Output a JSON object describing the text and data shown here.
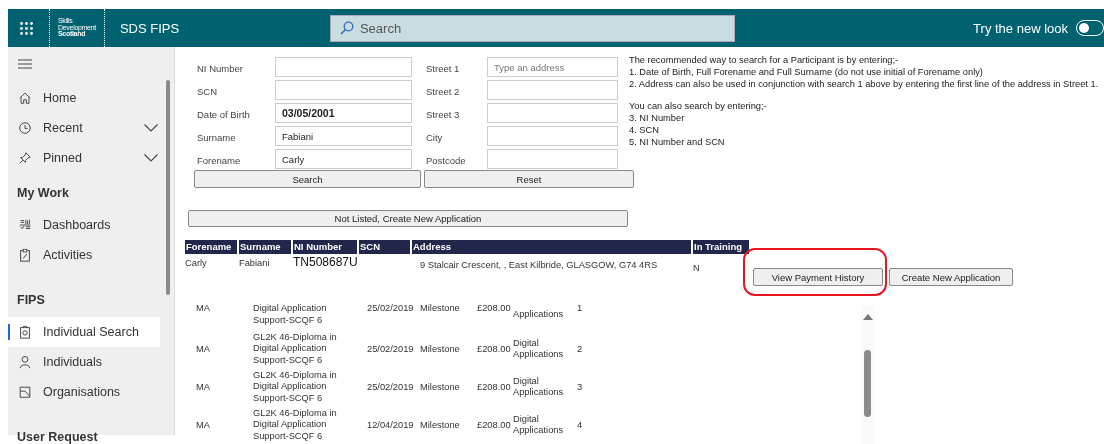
{
  "top_bar": {
    "logo_lines": [
      "Skills",
      "Development",
      "Scotland"
    ],
    "app_name": "SDS FIPS",
    "search": {
      "placeholder": "Search"
    },
    "new_look": {
      "label": "Try the new look",
      "on": false
    }
  },
  "sidebar": {
    "items": [
      {
        "kind": "link",
        "label": "Home",
        "selected": false
      },
      {
        "kind": "group",
        "label": "Recent",
        "selected": false
      },
      {
        "kind": "group",
        "label": "Pinned",
        "selected": false
      },
      {
        "kind": "heading",
        "label": "My Work"
      },
      {
        "kind": "link",
        "label": "Dashboards",
        "selected": false
      },
      {
        "kind": "link",
        "label": "Activities",
        "selected": false
      },
      {
        "kind": "heading",
        "label": "FIPS"
      },
      {
        "kind": "link",
        "label": "Individual Search",
        "selected": true
      },
      {
        "kind": "link",
        "label": "Individuals",
        "selected": false
      },
      {
        "kind": "link",
        "label": "Organisations",
        "selected": false
      },
      {
        "kind": "heading",
        "label": "User Request"
      }
    ]
  },
  "form": {
    "left_fields": [
      {
        "label": "NI Number"
      },
      {
        "label": "SCN"
      },
      {
        "label": "Date of Birth",
        "value": "03/05/2001"
      },
      {
        "label": "Surname",
        "value": "Fabiani"
      },
      {
        "label": "Forename",
        "value": "Carly"
      }
    ],
    "right_fields": [
      {
        "label": "Street 1",
        "placeholder": "Type an address"
      },
      {
        "label": "Street 2"
      },
      {
        "label": "Street 3"
      },
      {
        "label": "City"
      },
      {
        "label": "Postcode"
      }
    ],
    "instructions": [
      [
        "The recommended way to search for a Participant is by entering;-",
        "1. Date of Birth, Full Forename and Full Surname (do not use initial of Forename only)",
        "2. Address can also be used in conjunction with search 1 above by entering the first line of the address in Street 1."
      ],
      [
        "You can also search by entering;-",
        "3. NI Number",
        "4. SCN",
        "5. NI Number and SCN"
      ]
    ],
    "search_button": "Search",
    "reset_button": "Reset"
  },
  "create_button": "Not Listed, Create New Application",
  "results": {
    "columns": [
      "Forename",
      "Surname",
      "NI Number",
      "SCN",
      "Address",
      "In Training"
    ],
    "rows": [
      {
        "forename": "Carly",
        "surname": "Fabiani",
        "ni_number": "TN508687U",
        "address": "9 Stalcair Crescent,  , East Kilbride, GLASGOW, G74  4RS",
        "in_training": "N"
      }
    ],
    "buttons": [
      "View Payment History",
      "Create New Application"
    ]
  },
  "payments": [
    {
      "programme": "MA",
      "course": [
        "Digital Application",
        "Support-SCQF 6"
      ],
      "date": "25/02/2019",
      "type": "Milestone",
      "amount": "£208.00",
      "category": [
        "Applications"
      ],
      "number": "1"
    },
    {
      "programme": "MA",
      "course": [
        "GL2K 46-Diploma in",
        "Digital Application",
        "Support-SCQF 6"
      ],
      "date": "25/02/2019",
      "type": "Milestone",
      "amount": "£208.00",
      "category": [
        "Digital",
        "Applications"
      ],
      "number": "2"
    },
    {
      "programme": "MA",
      "course": [
        "GL2K 46-Diploma in",
        "Digital Application",
        "Support-SCQF 6"
      ],
      "date": "25/02/2019",
      "type": "Milestone",
      "amount": "£208.00",
      "category": [
        "Digital",
        "Applications"
      ],
      "number": "3"
    },
    {
      "programme": "MA",
      "course": [
        "GL2K 46-Diploma in",
        "Digital Application",
        "Support-SCQF 6"
      ],
      "date": "12/04/2019",
      "type": "Milestone",
      "amount": "£208.00",
      "category": [
        "Digital",
        "Applications"
      ],
      "number": "4"
    }
  ]
}
